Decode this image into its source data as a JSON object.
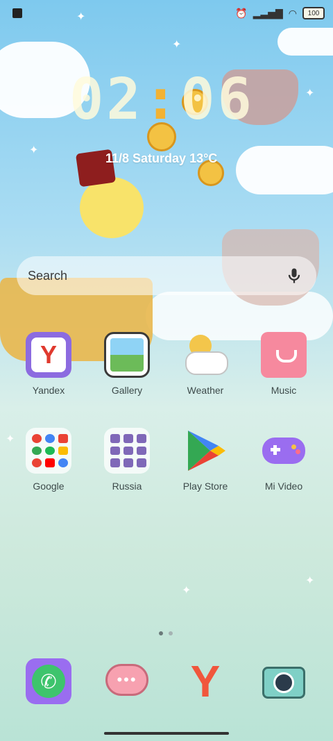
{
  "status": {
    "battery": "100"
  },
  "clock": {
    "hours": "02",
    "minutes": "06",
    "date": "11/8  Saturday  13°C"
  },
  "search": {
    "placeholder": "Search"
  },
  "apps_row1": [
    {
      "label": "Yandex"
    },
    {
      "label": "Gallery"
    },
    {
      "label": "Weather"
    },
    {
      "label": "Music"
    }
  ],
  "apps_row2": [
    {
      "label": "Google"
    },
    {
      "label": "Russia"
    },
    {
      "label": "Play Store"
    },
    {
      "label": "Mi Video"
    }
  ],
  "colors": {
    "accent": "#f2b233",
    "sky": "#7ec9ee"
  },
  "dock_icons": [
    "phone-icon",
    "messages-icon",
    "yandex-browser-icon",
    "camera-icon"
  ]
}
